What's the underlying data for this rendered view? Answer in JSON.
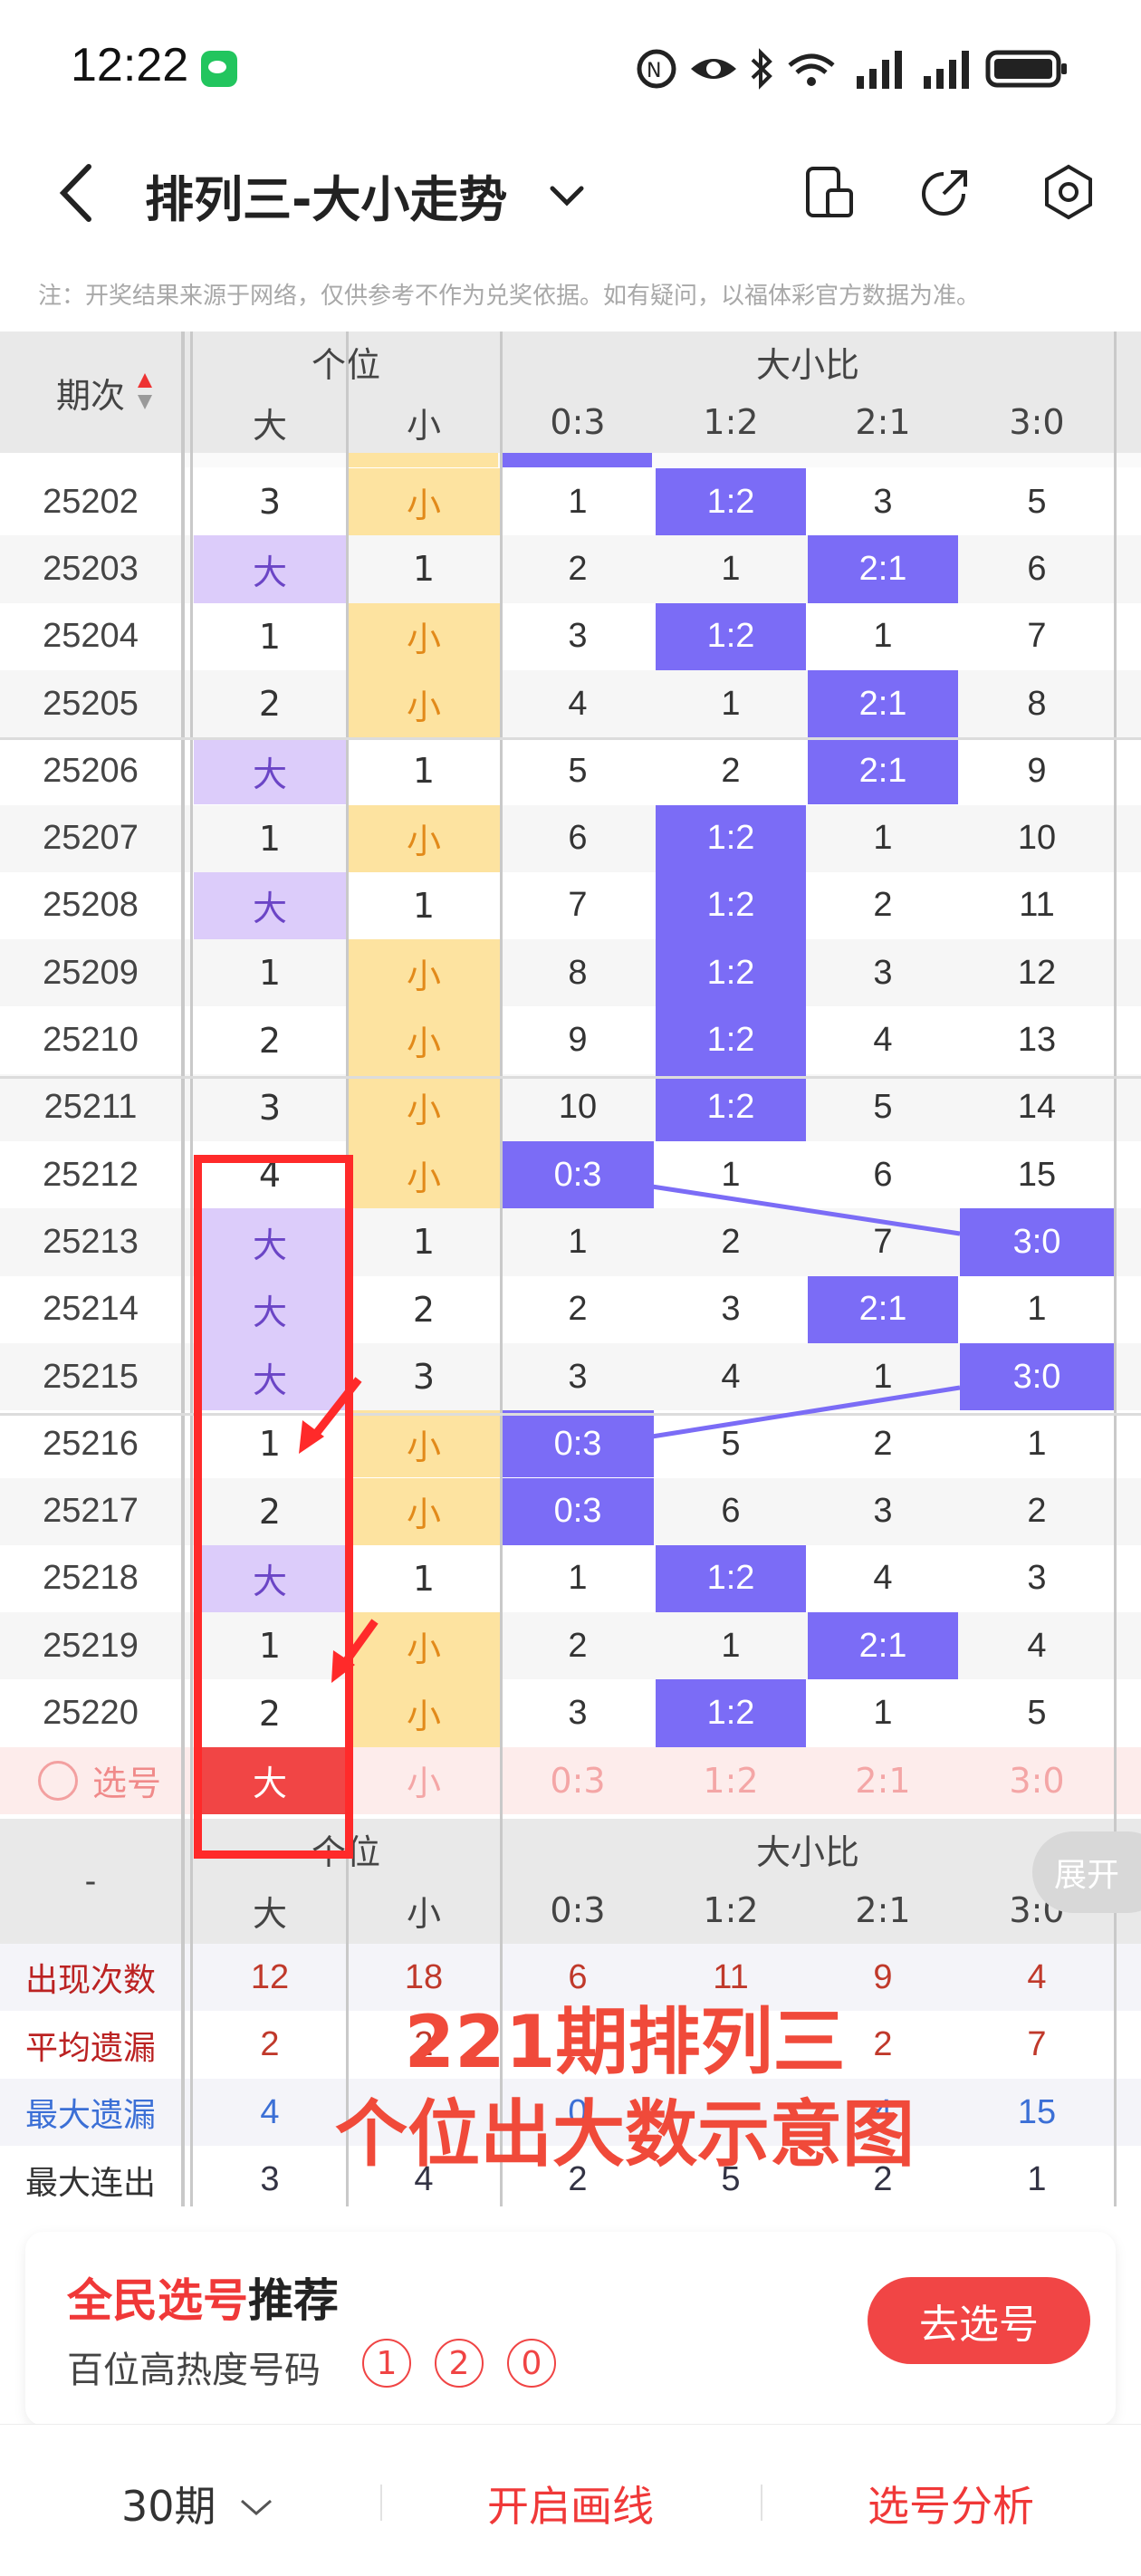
{
  "status": {
    "time": "12:22"
  },
  "header": {
    "title": "排列三-大小走势"
  },
  "note": "注：开奖结果来源于网络，仅供参考不作为兑奖依据。如有疑问，以福体彩官方数据为准。",
  "table": {
    "period_label": "期次",
    "group_geiwei": "个位",
    "group_ratio": "大小比",
    "sub_cols": [
      "大",
      "小",
      "0:3",
      "1:2",
      "2:1",
      "3:0"
    ],
    "rows": [
      {
        "issue": "25202",
        "g": [
          "3",
          "小"
        ],
        "r": [
          "1",
          "1:2",
          "3",
          "5"
        ]
      },
      {
        "issue": "25203",
        "g": [
          "大",
          "1"
        ],
        "r": [
          "2",
          "1",
          "2:1",
          "6"
        ]
      },
      {
        "issue": "25204",
        "g": [
          "1",
          "小"
        ],
        "r": [
          "3",
          "1:2",
          "1",
          "7"
        ]
      },
      {
        "issue": "25205",
        "g": [
          "2",
          "小"
        ],
        "r": [
          "4",
          "1",
          "2:1",
          "8"
        ]
      },
      {
        "issue": "25206",
        "g": [
          "大",
          "1"
        ],
        "r": [
          "5",
          "2",
          "2:1",
          "9"
        ]
      },
      {
        "issue": "25207",
        "g": [
          "1",
          "小"
        ],
        "r": [
          "6",
          "1:2",
          "1",
          "10"
        ]
      },
      {
        "issue": "25208",
        "g": [
          "大",
          "1"
        ],
        "r": [
          "7",
          "1:2",
          "2",
          "11"
        ]
      },
      {
        "issue": "25209",
        "g": [
          "1",
          "小"
        ],
        "r": [
          "8",
          "1:2",
          "3",
          "12"
        ]
      },
      {
        "issue": "25210",
        "g": [
          "2",
          "小"
        ],
        "r": [
          "9",
          "1:2",
          "4",
          "13"
        ]
      },
      {
        "issue": "25211",
        "g": [
          "3",
          "小"
        ],
        "r": [
          "10",
          "1:2",
          "5",
          "14"
        ]
      },
      {
        "issue": "25212",
        "g": [
          "4",
          "小"
        ],
        "r": [
          "0:3",
          "1",
          "6",
          "15"
        ]
      },
      {
        "issue": "25213",
        "g": [
          "大",
          "1"
        ],
        "r": [
          "1",
          "2",
          "7",
          "3:0"
        ]
      },
      {
        "issue": "25214",
        "g": [
          "大",
          "2"
        ],
        "r": [
          "2",
          "3",
          "2:1",
          "1"
        ]
      },
      {
        "issue": "25215",
        "g": [
          "大",
          "3"
        ],
        "r": [
          "3",
          "4",
          "1",
          "3:0"
        ]
      },
      {
        "issue": "25216",
        "g": [
          "1",
          "小"
        ],
        "r": [
          "0:3",
          "5",
          "2",
          "1"
        ]
      },
      {
        "issue": "25217",
        "g": [
          "2",
          "小"
        ],
        "r": [
          "0:3",
          "6",
          "3",
          "2"
        ]
      },
      {
        "issue": "25218",
        "g": [
          "大",
          "1"
        ],
        "r": [
          "1",
          "1:2",
          "4",
          "3"
        ]
      },
      {
        "issue": "25219",
        "g": [
          "1",
          "小"
        ],
        "r": [
          "2",
          "1",
          "2:1",
          "4"
        ]
      },
      {
        "issue": "25220",
        "g": [
          "2",
          "小"
        ],
        "r": [
          "3",
          "1:2",
          "1",
          "5"
        ]
      }
    ],
    "select_label": "选号",
    "select_row": [
      "大",
      "小",
      "0:3",
      "1:2",
      "2:1",
      "3:0"
    ],
    "bottom_dash": "-",
    "stats": [
      {
        "label": "出现次数",
        "values": [
          "12",
          "18",
          "6",
          "11",
          "9",
          "4"
        ]
      },
      {
        "label": "平均遗漏",
        "values": [
          "2",
          "2",
          "",
          "",
          "2",
          "7"
        ]
      },
      {
        "label": "最大遗漏",
        "values": [
          "4",
          "",
          "0",
          "",
          "4",
          "15"
        ]
      },
      {
        "label": "最大连出",
        "values": [
          "3",
          "4",
          "2",
          "5",
          "2",
          "1"
        ]
      }
    ]
  },
  "annotation": {
    "line1": "221期排列三",
    "line2": "个位出大数示意图"
  },
  "expand_label": "展开",
  "recommend": {
    "title_red": "全民选号",
    "title_black": "推荐",
    "subtitle": "百位高热度号码",
    "numbers": [
      "1",
      "2",
      "0"
    ],
    "button": "去选号"
  },
  "bottom": {
    "periods": "30期",
    "draw": "开启画线",
    "analysis": "选号分析"
  },
  "colors": {
    "purple_light": "#dcccfa",
    "yellow": "#fde3a0",
    "blue": "#7b6cf6",
    "red": "#f14545",
    "orange_text": "#e28a1a"
  }
}
